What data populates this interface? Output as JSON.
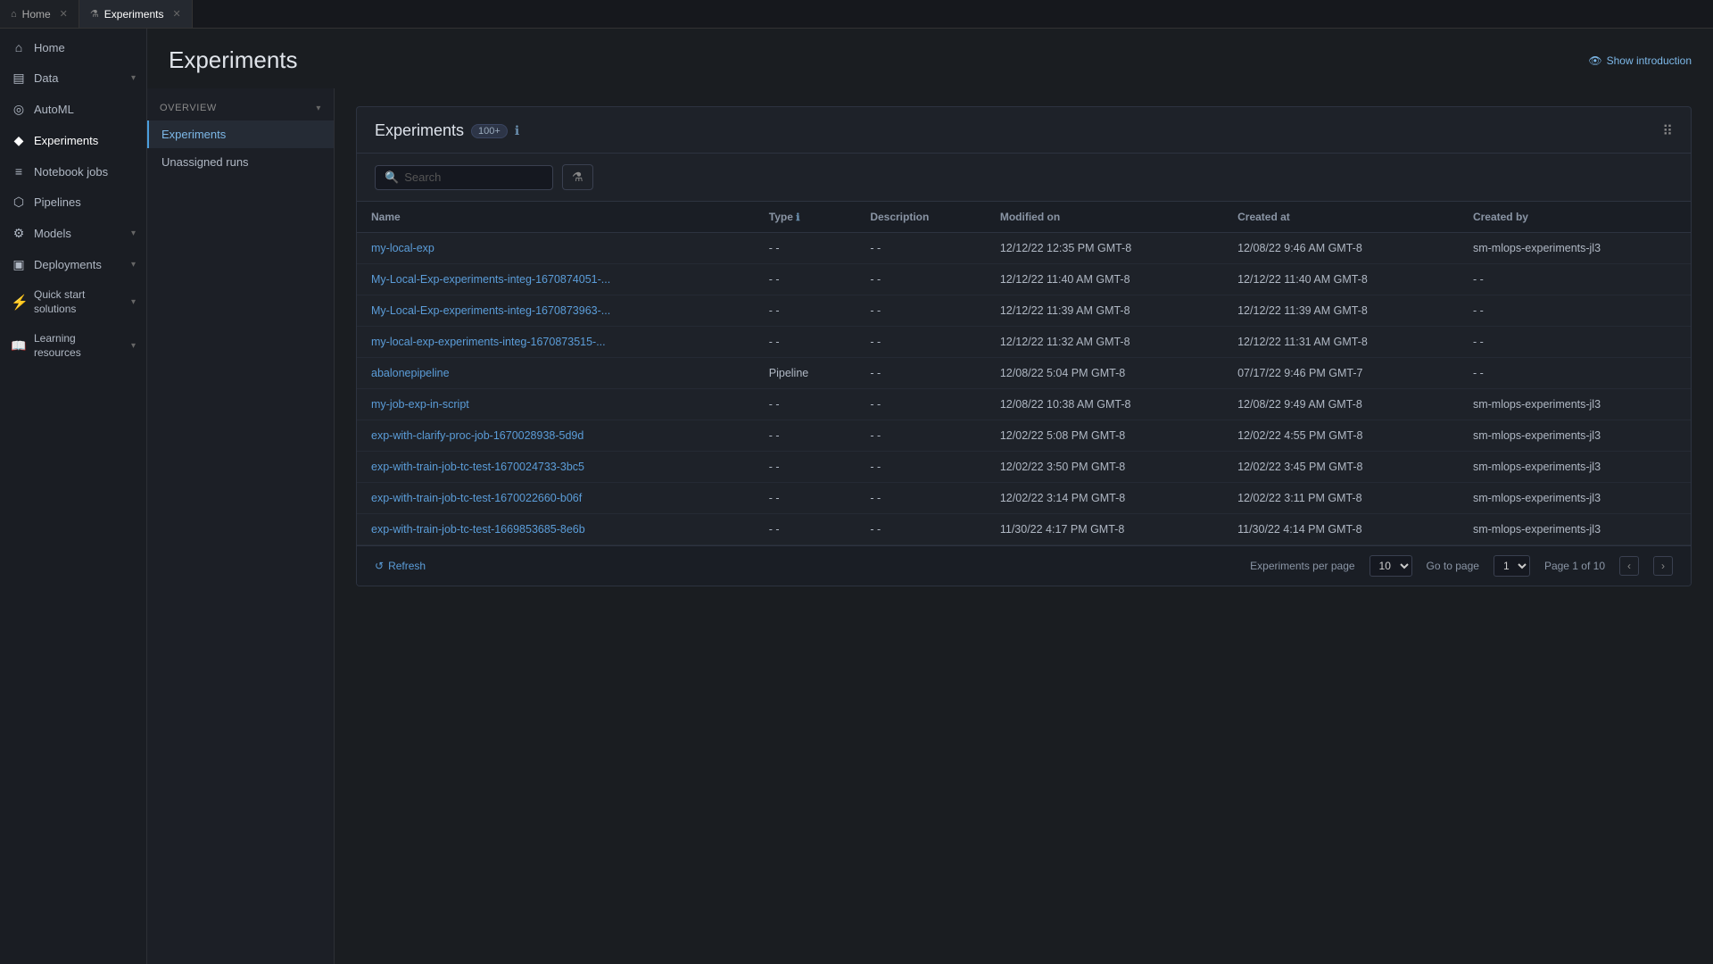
{
  "tabs": [
    {
      "id": "home",
      "label": "Home",
      "icon": "🏠",
      "active": false
    },
    {
      "id": "experiments",
      "label": "Experiments",
      "icon": "⚗",
      "active": true
    }
  ],
  "sidebar": {
    "items": [
      {
        "id": "home",
        "icon": "⌂",
        "label": "Home",
        "hasChevron": false
      },
      {
        "id": "data",
        "icon": "☰",
        "label": "Data",
        "hasChevron": true
      },
      {
        "id": "automl",
        "icon": "◎",
        "label": "AutoML",
        "hasChevron": false
      },
      {
        "id": "experiments",
        "icon": "◆",
        "label": "Experiments",
        "hasChevron": false
      },
      {
        "id": "notebook-jobs",
        "icon": "≡",
        "label": "Notebook jobs",
        "hasChevron": false
      },
      {
        "id": "pipelines",
        "icon": "⬡",
        "label": "Pipelines",
        "hasChevron": false
      },
      {
        "id": "models",
        "icon": "⚙",
        "label": "Models",
        "hasChevron": true
      },
      {
        "id": "deployments",
        "icon": "▣",
        "label": "Deployments",
        "hasChevron": true
      },
      {
        "id": "quick-start",
        "icon": "",
        "label": "Quick start solutions",
        "hasChevron": true
      },
      {
        "id": "learning",
        "icon": "",
        "label": "Learning resources",
        "hasChevron": true
      }
    ]
  },
  "page": {
    "title": "Experiments",
    "show_intro_label": "Show introduction"
  },
  "overview": {
    "header": "OVERVIEW",
    "nav_items": [
      {
        "id": "experiments",
        "label": "Experiments",
        "active": true
      },
      {
        "id": "unassigned-runs",
        "label": "Unassigned runs",
        "active": false
      }
    ]
  },
  "experiments_panel": {
    "title": "Experiments",
    "count": "100+",
    "search_placeholder": "Search",
    "columns": [
      "Name",
      "Type",
      "Description",
      "Modified on",
      "Created at",
      "Created by"
    ],
    "rows": [
      {
        "name": "my-local-exp",
        "type": "- -",
        "description": "- -",
        "modified": "12/12/22 12:35 PM GMT-8",
        "created": "12/08/22 9:46 AM GMT-8",
        "created_by": "sm-mlops-experiments-jl3"
      },
      {
        "name": "My-Local-Exp-experiments-integ-1670874051-...",
        "type": "- -",
        "description": "- -",
        "modified": "12/12/22 11:40 AM GMT-8",
        "created": "12/12/22 11:40 AM GMT-8",
        "created_by": "- -"
      },
      {
        "name": "My-Local-Exp-experiments-integ-1670873963-...",
        "type": "- -",
        "description": "- -",
        "modified": "12/12/22 11:39 AM GMT-8",
        "created": "12/12/22 11:39 AM GMT-8",
        "created_by": "- -"
      },
      {
        "name": "my-local-exp-experiments-integ-1670873515-...",
        "type": "- -",
        "description": "- -",
        "modified": "12/12/22 11:32 AM GMT-8",
        "created": "12/12/22 11:31 AM GMT-8",
        "created_by": "- -"
      },
      {
        "name": "abalonepipeline",
        "type": "Pipeline",
        "description": "- -",
        "modified": "12/08/22 5:04 PM GMT-8",
        "created": "07/17/22 9:46 PM GMT-7",
        "created_by": "- -"
      },
      {
        "name": "my-job-exp-in-script",
        "type": "- -",
        "description": "- -",
        "modified": "12/08/22 10:38 AM GMT-8",
        "created": "12/08/22 9:49 AM GMT-8",
        "created_by": "sm-mlops-experiments-jl3"
      },
      {
        "name": "exp-with-clarify-proc-job-1670028938-5d9d",
        "type": "- -",
        "description": "- -",
        "modified": "12/02/22 5:08 PM GMT-8",
        "created": "12/02/22 4:55 PM GMT-8",
        "created_by": "sm-mlops-experiments-jl3"
      },
      {
        "name": "exp-with-train-job-tc-test-1670024733-3bc5",
        "type": "- -",
        "description": "- -",
        "modified": "12/02/22 3:50 PM GMT-8",
        "created": "12/02/22 3:45 PM GMT-8",
        "created_by": "sm-mlops-experiments-jl3"
      },
      {
        "name": "exp-with-train-job-tc-test-1670022660-b06f",
        "type": "- -",
        "description": "- -",
        "modified": "12/02/22 3:14 PM GMT-8",
        "created": "12/02/22 3:11 PM GMT-8",
        "created_by": "sm-mlops-experiments-jl3"
      },
      {
        "name": "exp-with-train-job-tc-test-1669853685-8e6b",
        "type": "- -",
        "description": "- -",
        "modified": "11/30/22 4:17 PM GMT-8",
        "created": "11/30/22 4:14 PM GMT-8",
        "created_by": "sm-mlops-experiments-jl3"
      }
    ],
    "footer": {
      "refresh_label": "Refresh",
      "per_page_label": "Experiments per page",
      "per_page_value": "10",
      "goto_label": "Go to page",
      "goto_value": "1",
      "page_info": "Page 1 of 10"
    }
  }
}
